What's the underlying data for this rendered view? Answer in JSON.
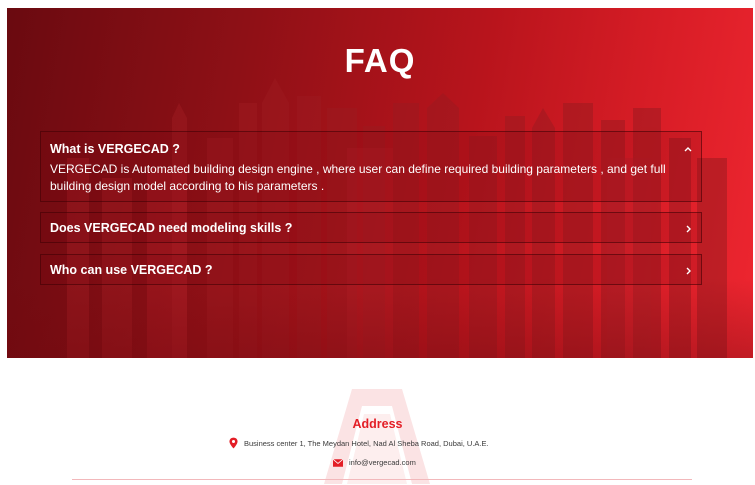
{
  "faq": {
    "title": "FAQ",
    "items": [
      {
        "question": "What is VERGECAD ?",
        "answer": "VERGECAD is Automated  building design engine , where user can define required building parameters , and get  full building design model according to his parameters .",
        "expanded": true,
        "icon": "chevron-up-icon"
      },
      {
        "question": "Does VERGECAD need modeling skills ?",
        "expanded": false,
        "icon": "chevron-right-icon"
      },
      {
        "question": "Who can use VERGECAD ?",
        "expanded": false,
        "icon": "chevron-right-icon"
      }
    ]
  },
  "footer": {
    "address_title": "Address",
    "address_line": "Business center 1, The Meydan Hotel, Nad Al Sheba Road, Dubai, U.A.E.",
    "email": "info@vergecad.com",
    "icons": [
      "location-pin-icon",
      "envelope-icon"
    ]
  },
  "colors": {
    "brand_red": "#e31e26",
    "hero_dark": "#6a0a10",
    "hero_light": "#ee2630",
    "text_white": "#ffffff",
    "footer_text": "#3a3a3a"
  }
}
